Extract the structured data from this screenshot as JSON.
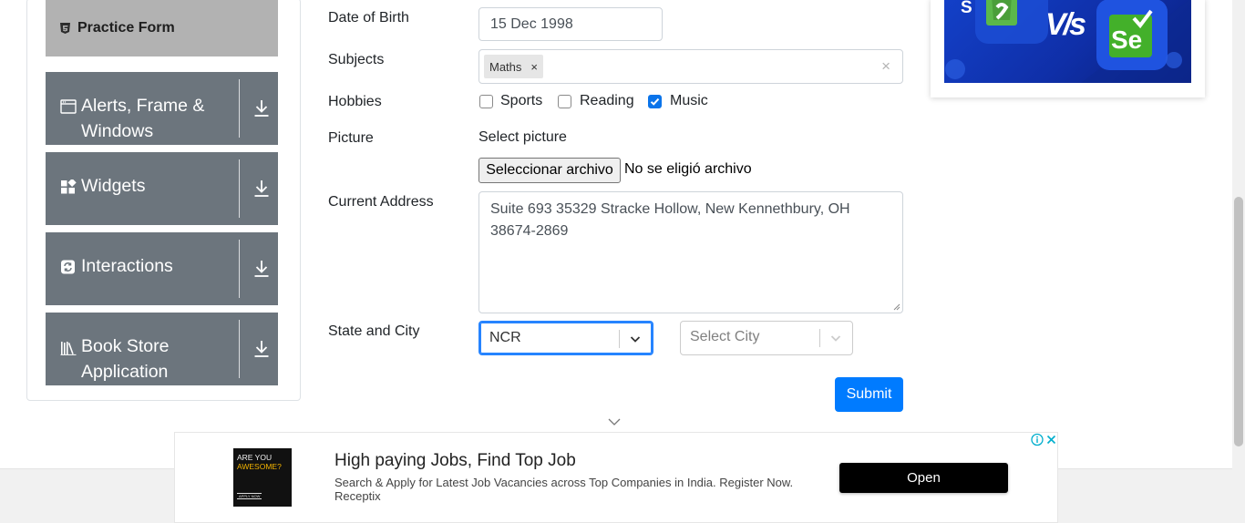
{
  "sidebar": {
    "active_item": "Practice Form",
    "groups": [
      {
        "label_line1": "Alerts, Frame &",
        "label_line2": "Windows",
        "icon": "window-icon"
      },
      {
        "label_line1": "Widgets",
        "icon": "widgets-icon"
      },
      {
        "label_line1": "Interactions",
        "icon": "interactions-icon"
      },
      {
        "label_line1": "Book Store",
        "label_line2": "Application",
        "icon": "book-icon"
      }
    ]
  },
  "form": {
    "dob_label": "Date of Birth",
    "dob_value": "15 Dec 1998",
    "subjects_label": "Subjects",
    "subjects": [
      {
        "label": "Maths"
      }
    ],
    "subjects_remove": "×",
    "subjects_clear": "×",
    "hobbies_label": "Hobbies",
    "hobbies": [
      {
        "label": "Sports",
        "checked": false
      },
      {
        "label": "Reading",
        "checked": false
      },
      {
        "label": "Music",
        "checked": true
      }
    ],
    "picture_label": "Picture",
    "select_picture": "Select picture",
    "file_button": "Seleccionar archivo",
    "file_status": "No se eligió archivo",
    "address_label": "Current Address",
    "address_value": "Suite 693 35329 Stracke Hollow, New Kennethbury, OH 38674-2869",
    "state_city_label": "State and City",
    "state_value": "NCR",
    "city_placeholder": "Select City",
    "submit_label": "Submit"
  },
  "bottom_ad": {
    "thumb_line1": "ARE YOU",
    "thumb_line2": "AWESOME?",
    "thumb_line3": "APPLY NOW",
    "title": "High paying Jobs, Find Top Job",
    "description": "Search & Apply for Latest Job Vacancies across Top Companies in India. Register Now.",
    "brand": "Receptix",
    "cta": "Open"
  },
  "right_ad": {
    "vs_text": "V/s",
    "se_text": "Se"
  },
  "colors": {
    "sidebar_group_bg": "#6c757d",
    "sidebar_active_bg": "#b2b2b2",
    "primary": "#007bff",
    "focus": "#2684ff"
  }
}
